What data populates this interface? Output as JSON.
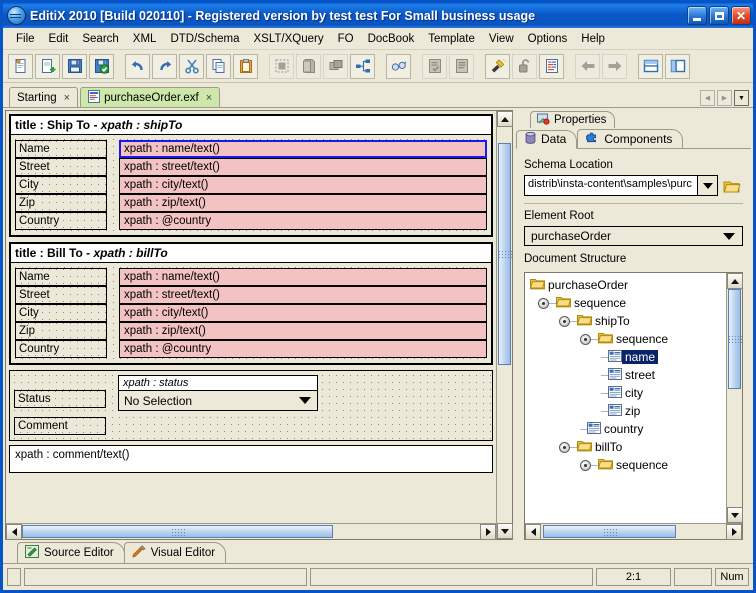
{
  "window": {
    "title": "EditiX 2010 [Build 020110] - Registered version by test test For Small business usage",
    "app_icon": "globe-icon",
    "buttons": {
      "minimize": "minimize-icon",
      "maximize": "maximize-icon",
      "close": "close-icon"
    },
    "accent": "#0754c6",
    "chrome_bg": "#ece9d8"
  },
  "menubar": {
    "items": [
      {
        "label": "File"
      },
      {
        "label": "Edit"
      },
      {
        "label": "Search"
      },
      {
        "label": "XML"
      },
      {
        "label": "DTD/Schema"
      },
      {
        "label": "XSLT/XQuery"
      },
      {
        "label": "FO"
      },
      {
        "label": "DocBook"
      },
      {
        "label": "Template"
      },
      {
        "label": "View"
      },
      {
        "label": "Options"
      },
      {
        "label": "Help"
      }
    ]
  },
  "toolbar": {
    "groups": [
      {
        "buttons": [
          {
            "name": "new-document-button",
            "icon": "new-document-icon",
            "enabled": true
          },
          {
            "name": "new-from-template-button",
            "icon": "document-add-icon",
            "enabled": true
          },
          {
            "name": "save-button",
            "icon": "floppy-save-icon",
            "enabled": true
          },
          {
            "name": "save-all-button",
            "icon": "floppy-check-icon",
            "enabled": true
          }
        ]
      },
      {
        "buttons": [
          {
            "name": "undo-button",
            "icon": "undo-arrow-icon",
            "enabled": true
          },
          {
            "name": "redo-button",
            "icon": "redo-arrow-icon",
            "enabled": true
          },
          {
            "name": "cut-button",
            "icon": "scissors-icon",
            "enabled": true
          },
          {
            "name": "copy-button",
            "icon": "copy-pages-icon",
            "enabled": true
          },
          {
            "name": "paste-button",
            "icon": "clipboard-icon",
            "enabled": true
          }
        ]
      },
      {
        "buttons": [
          {
            "name": "select-region-button",
            "icon": "dashed-square-icon",
            "enabled": false
          },
          {
            "name": "document-stack-button",
            "icon": "stacked-pages-icon",
            "enabled": false
          },
          {
            "name": "layers-button",
            "icon": "layers-icon",
            "enabled": false
          },
          {
            "name": "tree-view-button",
            "icon": "node-tree-icon",
            "enabled": true
          }
        ]
      },
      {
        "buttons": [
          {
            "name": "spellcheck-button",
            "icon": "glasses-icon",
            "enabled": true
          }
        ]
      },
      {
        "buttons": [
          {
            "name": "validate-button",
            "icon": "document-check-icon",
            "enabled": false
          },
          {
            "name": "format-button",
            "icon": "document-lines-icon",
            "enabled": false
          }
        ]
      },
      {
        "buttons": [
          {
            "name": "wizard-button",
            "icon": "magic-wand-icon",
            "enabled": true
          },
          {
            "name": "unlock-button",
            "icon": "open-padlock-icon",
            "enabled": false
          },
          {
            "name": "report-button",
            "icon": "report-document-icon",
            "enabled": true
          }
        ]
      },
      {
        "buttons": [
          {
            "name": "back-button",
            "icon": "arrow-left-icon",
            "enabled": false
          },
          {
            "name": "forward-button",
            "icon": "arrow-right-icon",
            "enabled": false
          }
        ]
      },
      {
        "buttons": [
          {
            "name": "split-horizontal-button",
            "icon": "split-horizontal-icon",
            "enabled": true
          },
          {
            "name": "split-vertical-button",
            "icon": "split-vertical-icon",
            "enabled": true
          }
        ]
      }
    ]
  },
  "document_tabs": {
    "tabs": [
      {
        "label": "Starting",
        "close": "×",
        "icon": null,
        "active": false
      },
      {
        "label": "purchaseOrder.exf",
        "close": "×",
        "icon": "xml-document-icon",
        "active": true
      }
    ],
    "nav": {
      "prev": "◀",
      "next": "▶",
      "list": "▼"
    }
  },
  "editor": {
    "groups": [
      {
        "title_label": "title : Ship To",
        "title_sep": " - ",
        "title_xpath": "xpath : shipTo",
        "rows": [
          {
            "label": "Name",
            "field": "xpath : name/text()",
            "selected": true
          },
          {
            "label": "Street",
            "field": "xpath : street/text()",
            "selected": false
          },
          {
            "label": "City",
            "field": "xpath : city/text()",
            "selected": false
          },
          {
            "label": "Zip",
            "field": "xpath : zip/text()",
            "selected": false
          },
          {
            "label": "Country",
            "field": "xpath : @country",
            "selected": false
          }
        ]
      },
      {
        "title_label": "title : Bill To",
        "title_sep": " - ",
        "title_xpath": "xpath : billTo",
        "rows": [
          {
            "label": "Name",
            "field": "xpath : name/text()",
            "selected": false
          },
          {
            "label": "Street",
            "field": "xpath : street/text()",
            "selected": false
          },
          {
            "label": "City",
            "field": "xpath : city/text()",
            "selected": false
          },
          {
            "label": "Zip",
            "field": "xpath : zip/text()",
            "selected": false
          },
          {
            "label": "Country",
            "field": "xpath : @country",
            "selected": false
          }
        ]
      }
    ],
    "status_row": {
      "label": "Status",
      "combo_xpath": "xpath : status",
      "combo_value": "No Selection"
    },
    "comment_row": {
      "label": "Comment",
      "textarea_value": "xpath : comment/text()"
    },
    "field_color": "#f3c2c2",
    "selected_border_color": "#1a1af0"
  },
  "properties": {
    "panel_tab": {
      "label": "Properties",
      "icon": "properties-icon"
    },
    "tabs": [
      {
        "label": "Data",
        "icon": "database-icon",
        "active": true
      },
      {
        "label": "Components",
        "icon": "puzzle-piece-icon",
        "active": false
      }
    ],
    "schema_location": {
      "label": "Schema Location",
      "value": "distrib\\insta-content\\samples\\purc",
      "dropdown_icon": "chevron-down-icon",
      "browse_icon": "folder-open-icon"
    },
    "element_root": {
      "label": "Element Root",
      "value": "purchaseOrder",
      "dropdown_icon": "chevron-down-icon"
    },
    "document_structure": {
      "label": "Document Structure",
      "nodes": [
        {
          "label": "purchaseOrder",
          "depth": 0,
          "type": "folder",
          "toggle": false,
          "selected": false
        },
        {
          "label": "sequence",
          "depth": 1,
          "type": "folder",
          "toggle": true,
          "selected": false
        },
        {
          "label": "shipTo",
          "depth": 2,
          "type": "folder",
          "toggle": true,
          "selected": false
        },
        {
          "label": "sequence",
          "depth": 3,
          "type": "folder",
          "toggle": true,
          "selected": false
        },
        {
          "label": "name",
          "depth": 4,
          "type": "element",
          "toggle": false,
          "selected": true
        },
        {
          "label": "street",
          "depth": 4,
          "type": "element",
          "toggle": false,
          "selected": false
        },
        {
          "label": "city",
          "depth": 4,
          "type": "element",
          "toggle": false,
          "selected": false
        },
        {
          "label": "zip",
          "depth": 4,
          "type": "element",
          "toggle": false,
          "selected": false
        },
        {
          "label": "country",
          "depth": 3,
          "type": "element",
          "toggle": false,
          "selected": false
        },
        {
          "label": "billTo",
          "depth": 2,
          "type": "folder",
          "toggle": true,
          "selected": false
        },
        {
          "label": "sequence",
          "depth": 3,
          "type": "folder",
          "toggle": true,
          "selected": false
        }
      ]
    }
  },
  "bottom_tabs": [
    {
      "label": "Source Editor",
      "icon": "source-editor-icon",
      "active": false
    },
    {
      "label": "Visual Editor",
      "icon": "visual-editor-icon",
      "active": true
    }
  ],
  "statusbar": {
    "message": "",
    "secondary": "",
    "caret_position": "2:1",
    "spare": "",
    "num_lock": "Num"
  }
}
